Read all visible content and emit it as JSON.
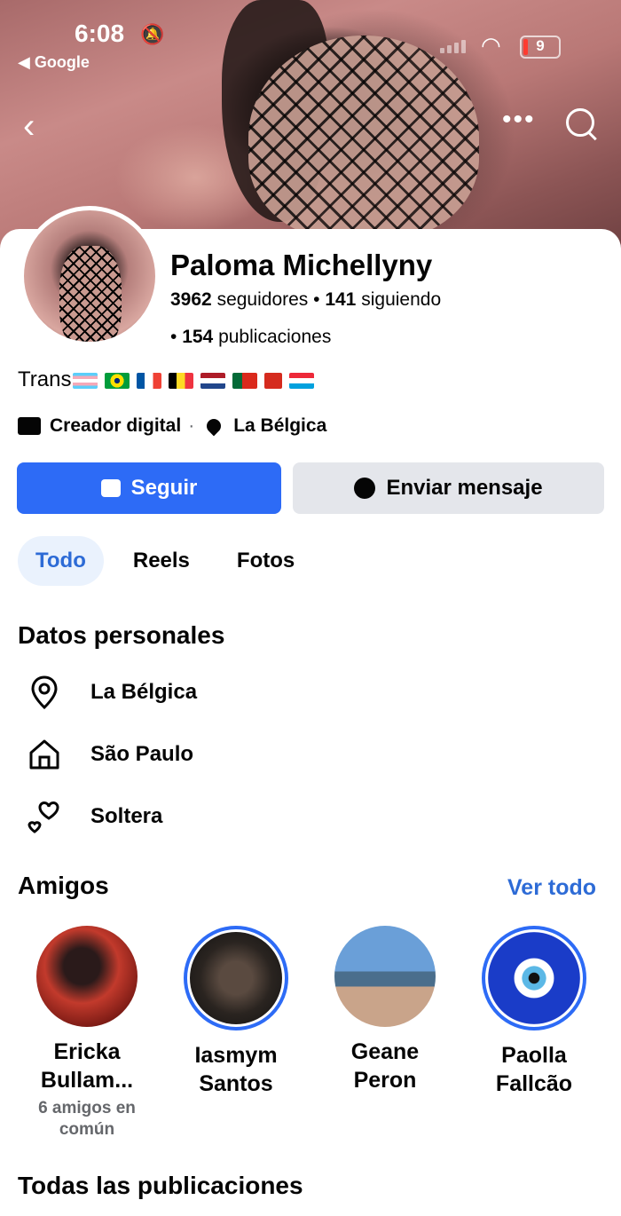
{
  "status_bar": {
    "time": "6:08",
    "back_app": "◀ Google",
    "battery": "9"
  },
  "profile": {
    "name": "Paloma Michellyny",
    "followers_count": "3962",
    "followers_label": "seguidores",
    "following_count": "141",
    "following_label": "siguiendo",
    "posts_count": "154",
    "posts_label": "publicaciones",
    "bio_text": "Trans",
    "bio_flags": [
      "transgender",
      "brazil",
      "france",
      "belgium",
      "netherlands",
      "portugal",
      "switzerland",
      "luxembourg"
    ],
    "category": "Creador digital",
    "location": "La Bélgica"
  },
  "actions": {
    "follow": "Seguir",
    "message": "Enviar mensaje"
  },
  "tabs": [
    "Todo",
    "Reels",
    "Fotos"
  ],
  "personal": {
    "title": "Datos personales",
    "items": [
      {
        "icon": "location-pin-icon",
        "label": "La Bélgica"
      },
      {
        "icon": "home-icon",
        "label": "São Paulo"
      },
      {
        "icon": "hearts-icon",
        "label": "Soltera"
      }
    ]
  },
  "friends": {
    "title": "Amigos",
    "see_all": "Ver todo",
    "list": [
      {
        "name_line1": "Ericka",
        "name_line2": "Bullam...",
        "mutual": "6 amigos en común"
      },
      {
        "name_line1": "Iasmym",
        "name_line2": "Santos",
        "mutual": ""
      },
      {
        "name_line1": "Geane",
        "name_line2": "Peron",
        "mutual": ""
      },
      {
        "name_line1": "Paolla",
        "name_line2": "Fallcão",
        "mutual": ""
      }
    ]
  },
  "all_posts_title": "Todas las publicaciones",
  "colors": {
    "primary": "#2d6bf6",
    "link": "#2d6bd6",
    "secondary_btn": "#e4e6eb"
  }
}
